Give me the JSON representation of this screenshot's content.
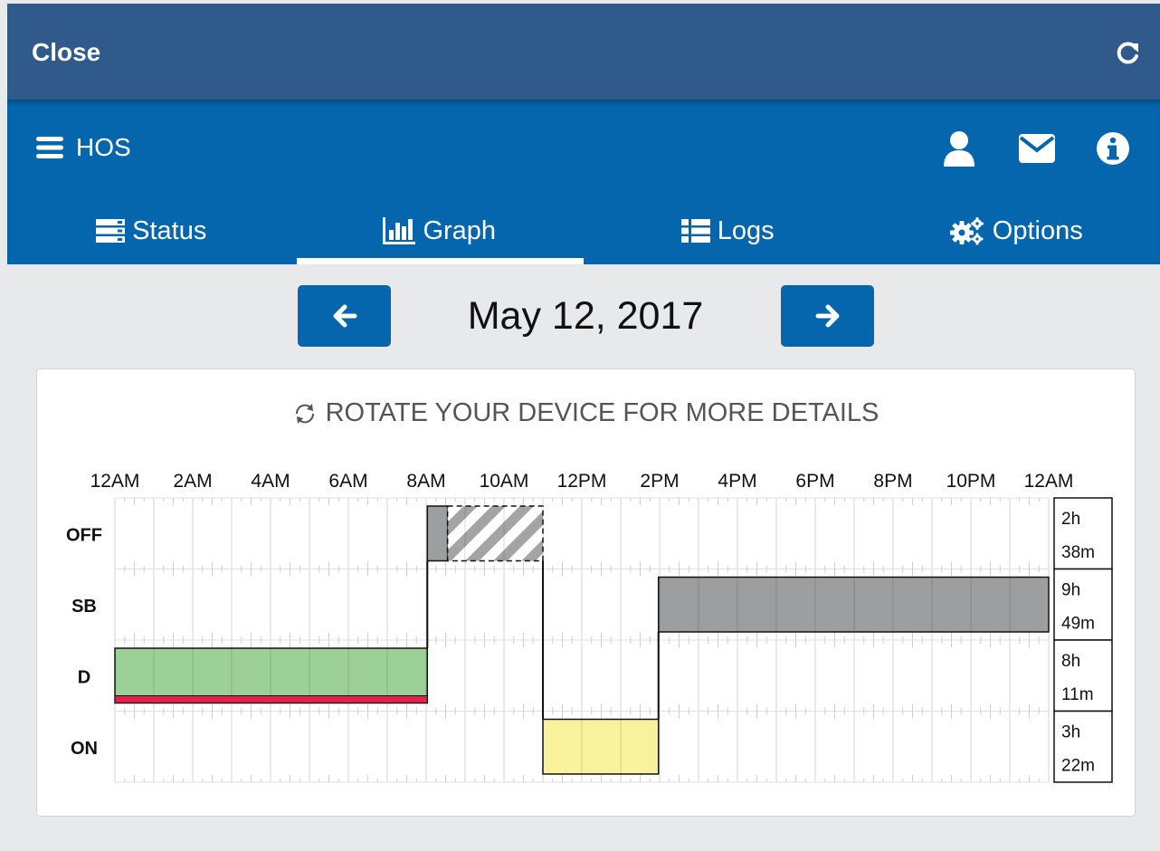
{
  "header": {
    "close_label": "Close",
    "refresh_icon": "refresh-icon"
  },
  "app": {
    "title": "HOS",
    "icons": [
      "user-icon",
      "mail-icon",
      "info-icon"
    ],
    "tabs": [
      {
        "label": "Status",
        "icon": "server-icon"
      },
      {
        "label": "Graph",
        "icon": "bar-chart-icon",
        "active": true
      },
      {
        "label": "Logs",
        "icon": "list-icon"
      },
      {
        "label": "Options",
        "icon": "cogs-icon"
      }
    ]
  },
  "date_nav": {
    "date": "May 12, 2017",
    "prev_icon": "arrow-left-icon",
    "next_icon": "arrow-right-icon"
  },
  "card": {
    "rotate_message": "ROTATE YOUR DEVICE FOR MORE DETAILS"
  },
  "chart_data": {
    "type": "hos-log-graph",
    "time_labels": [
      "12AM",
      "2AM",
      "4AM",
      "6AM",
      "8AM",
      "10AM",
      "12PM",
      "2PM",
      "4PM",
      "6PM",
      "8PM",
      "10PM",
      "12AM"
    ],
    "rows": [
      {
        "label": "OFF",
        "total": [
          "2h",
          "38m"
        ]
      },
      {
        "label": "SB",
        "total": [
          "9h",
          "49m"
        ]
      },
      {
        "label": "D",
        "total": [
          "8h",
          "11m"
        ]
      },
      {
        "label": "ON",
        "total": [
          "3h",
          "22m"
        ]
      }
    ],
    "segments": [
      {
        "row": "D",
        "start_hour": 0.0,
        "end_hour": 8.03,
        "fill": "#9dcf98",
        "violation_underline": "#e3224a"
      },
      {
        "row": "OFF",
        "start_hour": 8.03,
        "end_hour": 8.55,
        "fill": "#9d9ea0"
      },
      {
        "row": "OFF",
        "start_hour": 8.55,
        "end_hour": 11.0,
        "fill": "hatched",
        "style": "dashed"
      },
      {
        "row": "ON",
        "start_hour": 11.0,
        "end_hour": 13.97,
        "fill": "#f8f29d"
      },
      {
        "row": "SB",
        "start_hour": 13.97,
        "end_hour": 24.0,
        "fill": "#9d9ea0"
      }
    ]
  }
}
